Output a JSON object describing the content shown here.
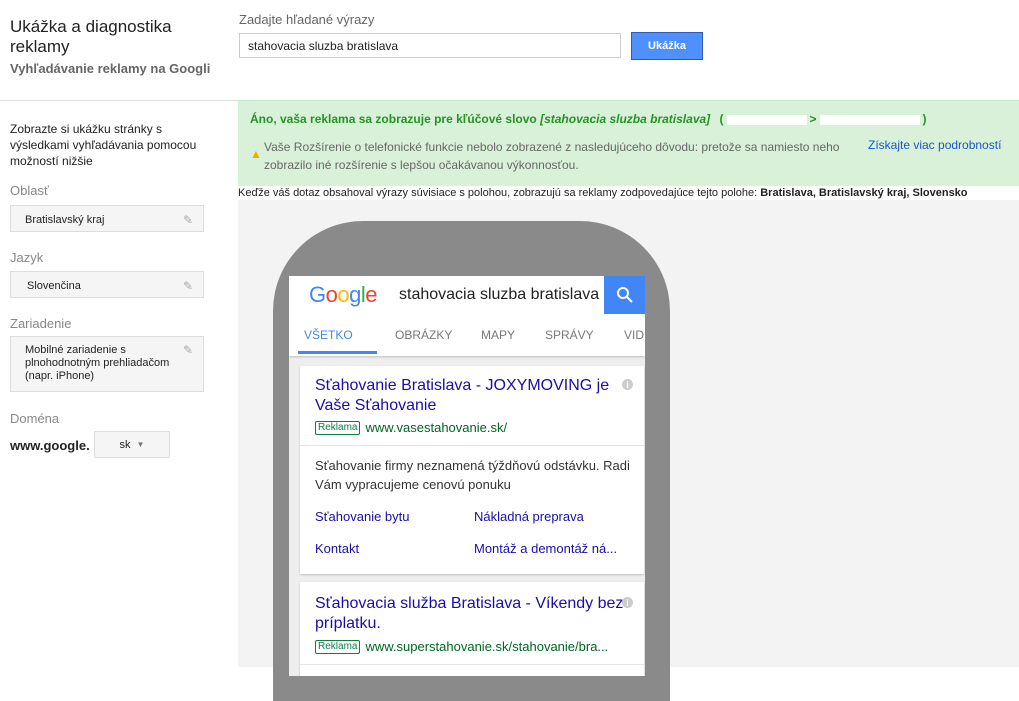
{
  "app": {
    "title": "Ukážka a diagnostika reklamy",
    "subtitle": "Vyhľadávanie reklamy na Googli"
  },
  "search": {
    "label": "Zadajte hľadané výrazy",
    "value": "stahovacia sluzba bratislava",
    "button": "Ukážka"
  },
  "sidebar": {
    "intro": "Zobrazte si ukážku stránky s výsledkami vyhľadávania pomocou možností nižšie",
    "area_label": "Oblasť",
    "area_value": "Bratislavský kraj",
    "language_label": "Jazyk",
    "language_value": "Slovenčina",
    "device_label": "Zariadenie",
    "device_value": "Mobilné zariadenie s plnohodnotným prehliadačom (napr. iPhone)",
    "domain_label": "Doména",
    "domain_prefix": "www.google.",
    "domain_value": "sk"
  },
  "banner": {
    "title_prefix": "Áno, vaša reklama sa zobrazuje pre kľúčové slovo ",
    "keyword": "[stahovacia sluzba bratislava]",
    "paren_open": "(",
    "arrow": ">",
    "paren_close": ")",
    "message": "Vaše Rozšírenie o telefonické funkcie nebolo zobrazené z nasledujúceho dôvodu: pretože sa namiesto neho zobrazilo iné rozšírenie s lepšou očakávanou výkonnosťou.",
    "more_link": "Získajte viac podrobností"
  },
  "location_note": {
    "text": "Keďže váš dotaz obsahoval výrazy súvisiace s polohou, zobrazujú sa reklamy zodpovedajúce tejto polohe: ",
    "location": "Bratislava, Bratislavský kraj, Slovensko"
  },
  "google": {
    "logo_letters": [
      "G",
      "o",
      "o",
      "g",
      "l",
      "e"
    ],
    "logo_colors": [
      "#4285f4",
      "#ea4335",
      "#fbbc05",
      "#4285f4",
      "#34a853",
      "#ea4335"
    ],
    "query": "stahovacia sluzba bratislava",
    "tabs": [
      "VŠETKO",
      "OBRÁZKY",
      "MAPY",
      "SPRÁVY",
      "VID"
    ]
  },
  "ads": [
    {
      "title": "Sťahovanie Bratislava - JOXYMOVING je Vaše Sťahovanie",
      "badge": "Reklama",
      "url": "www.vasestahovanie.sk/",
      "description": "Sťahovanie firmy neznamená týždňovú odstávku. Radi Vám vypracujeme cenovú ponuku",
      "links": [
        "Sťahovanie bytu",
        "Nákladná preprava",
        "Kontakt",
        "Montáž a demontáž ná..."
      ]
    },
    {
      "title": "Sťahovacia služba Bratislava - Víkendy bez príplatku.",
      "badge": "Reklama",
      "url": "www.superstahovanie.sk/stahovanie/bra..."
    }
  ],
  "colors": {
    "accent": "#4d90fe",
    "success": "#239423",
    "link": "#1a0dab"
  }
}
